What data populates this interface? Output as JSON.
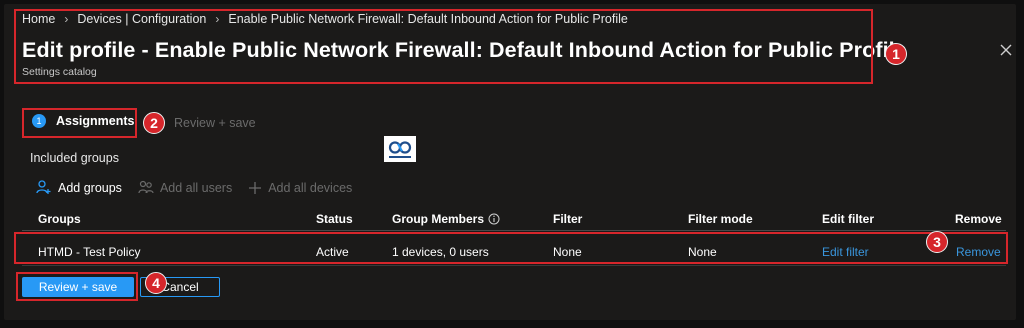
{
  "breadcrumb": [
    "Home",
    "Devices | Configuration",
    "Enable Public Network Firewall: Default Inbound Action for Public Profile"
  ],
  "header": {
    "title": "Edit profile - Enable Public Network Firewall: Default Inbound Action for Public Profile",
    "subtitle": "Settings catalog",
    "close_icon": "close-icon"
  },
  "steps": [
    {
      "number": "1",
      "label": "Assignments",
      "active": true
    },
    {
      "label": "Review + save",
      "active": false
    }
  ],
  "logo_text": "HTMD Community",
  "section_title": "Included groups",
  "commands": [
    {
      "label": "Add groups",
      "icon": "add-user-icon",
      "enabled": true
    },
    {
      "label": "Add all users",
      "icon": "users-icon",
      "enabled": false
    },
    {
      "label": "Add all devices",
      "icon": "plus-icon",
      "enabled": false
    }
  ],
  "table": {
    "columns": [
      "Groups",
      "Status",
      "Group Members",
      "Filter",
      "Filter mode",
      "Edit filter",
      "Remove"
    ],
    "rows": [
      {
        "group": "HTMD - Test Policy",
        "status": "Active",
        "members": "1 devices, 0 users",
        "filter": "None",
        "filter_mode": "None",
        "edit_filter": "Edit filter",
        "remove": "Remove"
      }
    ]
  },
  "buttons": {
    "primary": "Review + save",
    "secondary": "Cancel"
  },
  "annotations": [
    "1",
    "2",
    "3",
    "4"
  ],
  "colors": {
    "accent": "#2899f5",
    "link": "#3a96dd",
    "annotation": "#d6262b",
    "background": "#1b1a19"
  }
}
